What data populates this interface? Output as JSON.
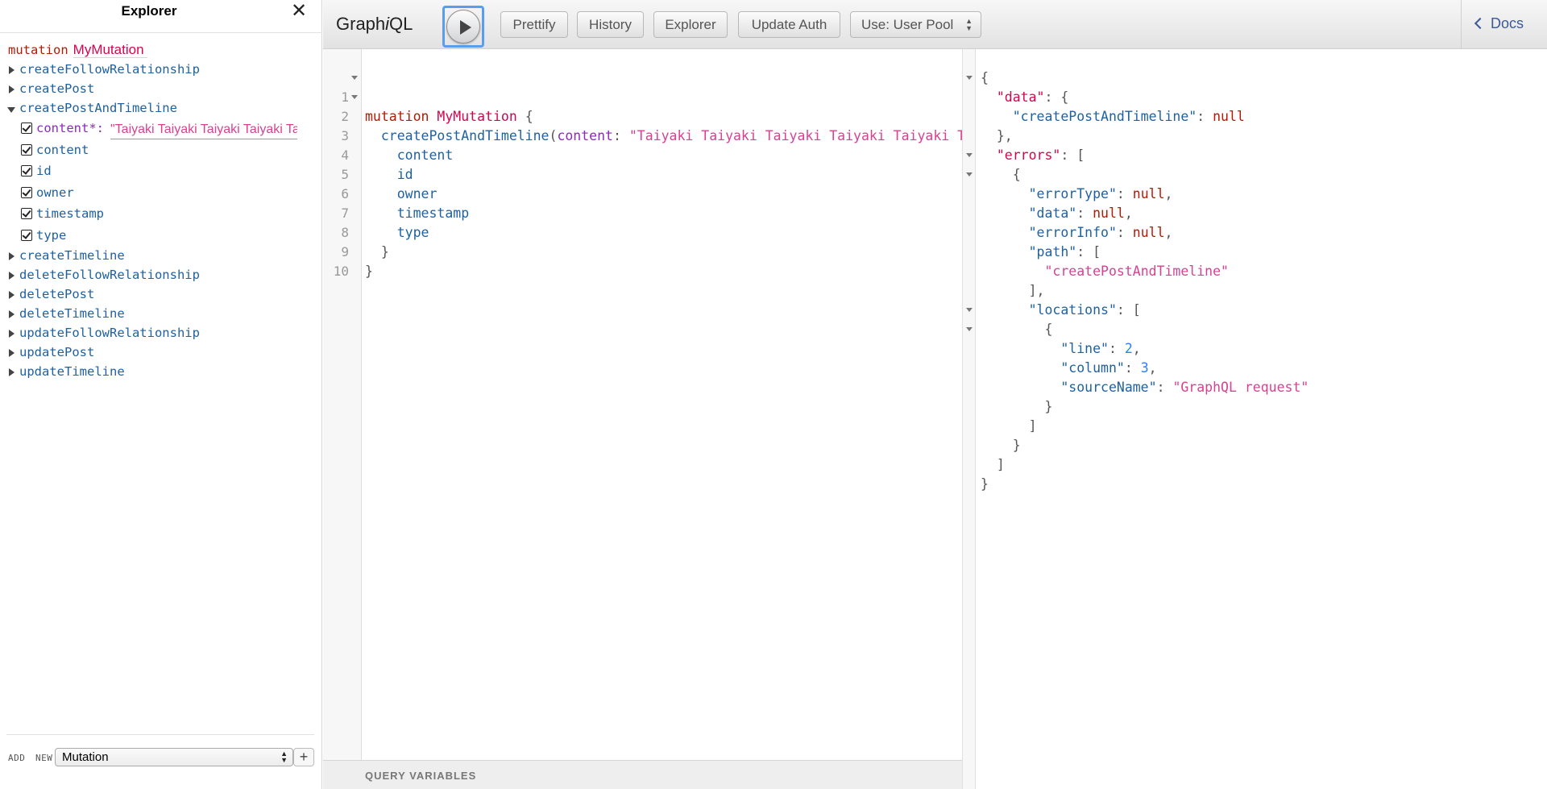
{
  "explorer": {
    "title": "Explorer",
    "close_icon": "close-icon",
    "operation": {
      "keyword": "mutation",
      "name": "MyMutation"
    },
    "fields_before": [
      "createFollowRelationship",
      "createPost"
    ],
    "expanded_field": {
      "name": "createPostAndTimeline",
      "argument": {
        "name": "content*:",
        "value": "\"Taiyaki Taiyaki Taiyaki Taiyaki Taiyaki\""
      },
      "subfields": [
        "content",
        "id",
        "owner",
        "timestamp",
        "type"
      ]
    },
    "fields_after": [
      "createTimeline",
      "deleteFollowRelationship",
      "deletePost",
      "deleteTimeline",
      "updateFollowRelationship",
      "updatePost",
      "updateTimeline"
    ],
    "footer": {
      "add_label": "ADD",
      "new_label": "NEW",
      "selected_type": "Mutation",
      "add_button": "+"
    }
  },
  "toolbar": {
    "title_prefix": "Graph",
    "title_italic": "i",
    "title_suffix": "QL",
    "execute_icon": "play-icon",
    "buttons": [
      "Prettify",
      "History",
      "Explorer",
      "Update Auth"
    ],
    "auth_select": "Use: User Pool",
    "docs_label": "Docs"
  },
  "editor": {
    "line_numbers": [
      "1",
      "2",
      "3",
      "4",
      "5",
      "6",
      "7",
      "8",
      "9",
      "10"
    ],
    "line1": {
      "kw": "mutation",
      "name": "MyMutation",
      "brace": " {"
    },
    "line2": {
      "field": "createPostAndTimeline",
      "paren": "(",
      "arg": "content",
      "colon": ": ",
      "value": "\"Taiyaki Taiyaki Taiyaki Taiyaki Taiyaki Ta"
    },
    "subfields": [
      "content",
      "id",
      "owner",
      "timestamp",
      "type"
    ],
    "close_inner": "}",
    "close_outer": "}",
    "query_variables_label": "QUERY VARIABLES"
  },
  "result": {
    "open": "{",
    "data_key": "\"data\"",
    "data_open": ": {",
    "cpat_key": "\"createPostAndTimeline\"",
    "null": "null",
    "data_close": "},",
    "errors_key": "\"errors\"",
    "errors_open": ": [",
    "obj_open": "{",
    "errorType_key": "\"errorType\"",
    "data2_key": "\"data\"",
    "errorInfo_key": "\"errorInfo\"",
    "path_key": "\"path\"",
    "path_value": "\"createPostAndTimeline\"",
    "path_close": "],",
    "locations_key": "\"locations\"",
    "line_key": "\"line\"",
    "line_value": "2",
    "column_key": "\"column\"",
    "column_value": "3",
    "sourceName_key": "\"sourceName\"",
    "sourceName_value": "\"GraphQL request\"",
    "close_brace": "}",
    "close_bracket": "]"
  }
}
